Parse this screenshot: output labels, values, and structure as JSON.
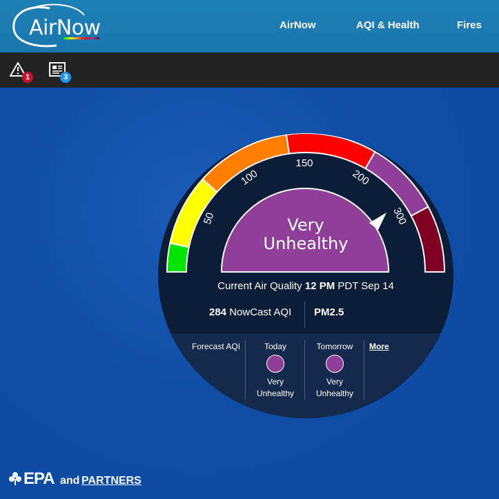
{
  "header": {
    "logo_text": "AirNow",
    "nav": [
      {
        "label": "AirNow"
      },
      {
        "label": "AQI & Health"
      },
      {
        "label": "Fires"
      }
    ]
  },
  "toolbar": {
    "alerts_count": "1",
    "news_count": "3",
    "alert_badge_color": "#c8102e",
    "news_badge_color": "#2196f3"
  },
  "gauge": {
    "ticks": [
      "50",
      "100",
      "150",
      "200",
      "300"
    ],
    "category": [
      "Very",
      "Unhealthy"
    ],
    "segment_colors": [
      "#00e400",
      "#ffff00",
      "#ff7e00",
      "#ff0000",
      "#8f3f97",
      "#7e0023"
    ],
    "category_color": "#8f3f97"
  },
  "current": {
    "prefix": "Current Air Quality",
    "time": "12 PM",
    "suffix": "PDT Sep 14",
    "aqi_value": "284",
    "aqi_label": "NowCast AQI",
    "pollutant": "PM2.5"
  },
  "forecast": {
    "title": "Forecast AQI",
    "days": [
      {
        "label": "Today",
        "category": [
          "Very",
          "Unhealthy"
        ]
      },
      {
        "label": "Tomorrow",
        "category": [
          "Very",
          "Unhealthy"
        ]
      }
    ],
    "more_label": "More"
  },
  "footer": {
    "epa": "EPA",
    "and": "and",
    "partners": "PARTNERS"
  }
}
